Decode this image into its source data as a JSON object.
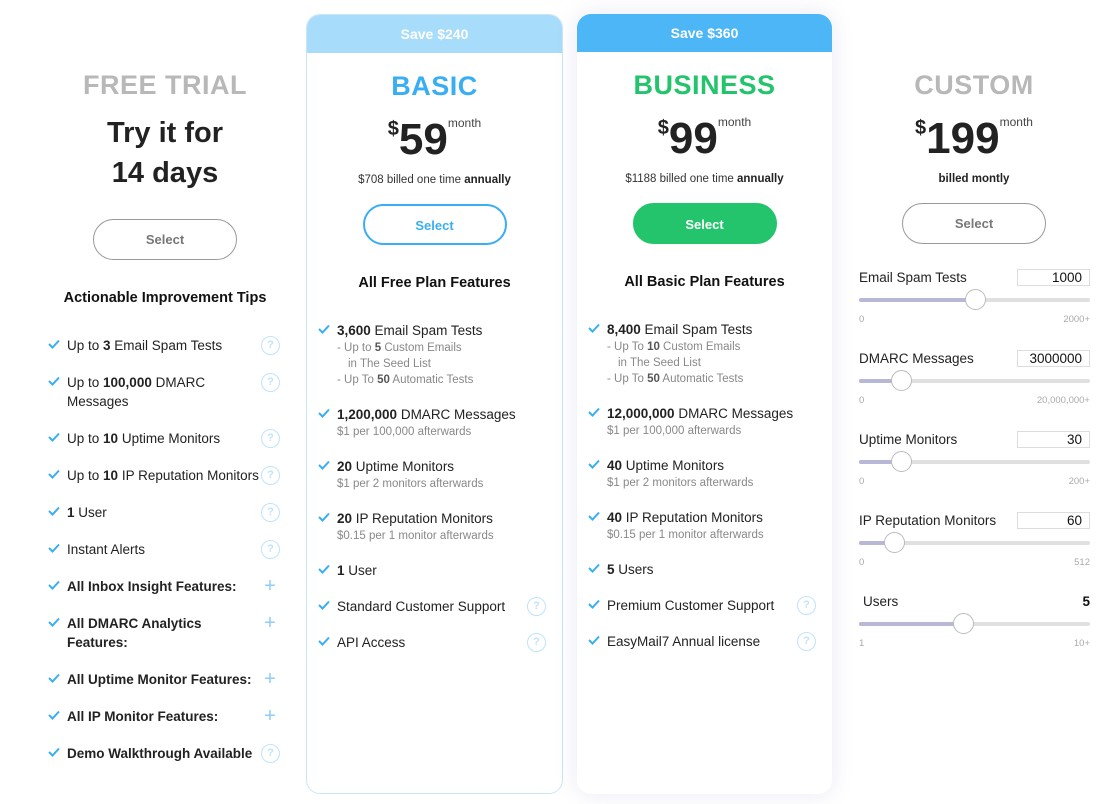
{
  "plans": {
    "free": {
      "title": "FREE TRIAL",
      "try_line1": "Try it for",
      "try_line2": "14 days",
      "select_label": "Select",
      "heading": "Actionable Improvement Tips",
      "features": [
        {
          "pre": "Up to ",
          "bold": "3",
          "post": " Email Spam Tests",
          "icon": "help-icon"
        },
        {
          "pre": "Up to ",
          "bold": "100,000",
          "post": " DMARC Messages",
          "icon": "help-icon"
        },
        {
          "pre": "Up to ",
          "bold": "10",
          "post": " Uptime Monitors",
          "icon": "help-icon"
        },
        {
          "pre": "Up to ",
          "bold": "10",
          "post": " IP Reputation Monitors",
          "icon": "help-icon"
        },
        {
          "pre": "",
          "bold": "1",
          "post": " User",
          "icon": "help-icon"
        },
        {
          "pre": "Instant Alerts",
          "bold": "",
          "post": "",
          "icon": "help-icon"
        },
        {
          "pre": "",
          "bold": "All Inbox Insight Features:",
          "post": "",
          "icon": "plus-icon"
        },
        {
          "pre": "",
          "bold": "All DMARC Analytics Features:",
          "post": "",
          "icon": "plus-icon"
        },
        {
          "pre": "",
          "bold": "All Uptime Monitor Features:",
          "post": "",
          "icon": "plus-icon"
        },
        {
          "pre": "",
          "bold": "All IP Monitor Features:",
          "post": "",
          "icon": "plus-icon"
        },
        {
          "pre": "",
          "bold": "Demo Walkthrough Available",
          "post": "",
          "icon": "help-icon"
        }
      ]
    },
    "basic": {
      "save_banner": "Save $240",
      "title": "BASIC",
      "currency": "$",
      "price": "59",
      "period": "month",
      "billing_pre": "$708 billed one time ",
      "billing_bold": "annually",
      "select_label": "Select",
      "heading": "All Free Plan Features",
      "spam": {
        "bold": "3,600",
        "post": " Email Spam Tests",
        "sub1_pre": "- Up to ",
        "sub1_bold": "5",
        "sub1_post": " Custom Emails",
        "sub2": "in The Seed List",
        "sub3_pre": "- Up To ",
        "sub3_bold": "50",
        "sub3_post": " Automatic Tests"
      },
      "dmarc": {
        "bold": "1,200,000",
        "post": " DMARC Messages",
        "sub": "$1 per 100,000 afterwards"
      },
      "uptime": {
        "bold": "20",
        "post": " Uptime Monitors",
        "sub": "$1 per 2 monitors afterwards"
      },
      "ip": {
        "bold": "20",
        "post": " IP Reputation Monitors",
        "sub": "$0.15 per 1 monitor afterwards"
      },
      "users": {
        "bold": "1",
        "post": " User"
      },
      "support": "Standard Customer Support",
      "extra": "API Access"
    },
    "business": {
      "save_banner": "Save $360",
      "title": "BUSINESS",
      "currency": "$",
      "price": "99",
      "period": "month",
      "billing_pre": "$1188 billed one time ",
      "billing_bold": "annually",
      "select_label": "Select",
      "heading": "All Basic Plan Features",
      "spam": {
        "bold": "8,400",
        "post": " Email Spam Tests",
        "sub1_pre": "- Up To ",
        "sub1_bold": "10",
        "sub1_post": " Custom Emails",
        "sub2": "in The Seed List",
        "sub3_pre": "- Up To ",
        "sub3_bold": "50",
        "sub3_post": " Automatic Tests"
      },
      "dmarc": {
        "bold": "12,000,000",
        "post": " DMARC Messages",
        "sub": "$1 per 100,000 afterwards"
      },
      "uptime": {
        "bold": "40",
        "post": " Uptime Monitors",
        "sub": "$1 per 2 monitors afterwards"
      },
      "ip": {
        "bold": "40",
        "post": " IP Reputation Monitors",
        "sub": "$0.15 per 1 monitor afterwards"
      },
      "users": {
        "bold": "5",
        "post": " Users"
      },
      "support": "Premium Customer Support",
      "extra": "EasyMail7 Annual license"
    },
    "custom": {
      "title": "CUSTOM",
      "currency": "$",
      "price": "199",
      "period": "month",
      "billing": "billed montly",
      "select_label": "Select",
      "sliders": [
        {
          "label": "Email Spam Tests",
          "value": "1000",
          "min_label": "0",
          "max_label": "2000+",
          "fraction": 0.5,
          "type": "input"
        },
        {
          "label": "DMARC Messages",
          "value": "3000000",
          "min_label": "0",
          "max_label": "20,000,000+",
          "fraction": 0.18,
          "type": "input"
        },
        {
          "label": "Uptime Monitors",
          "value": "30",
          "min_label": "0",
          "max_label": "200+",
          "fraction": 0.18,
          "type": "input"
        },
        {
          "label": "IP Reputation Monitors",
          "value": "60",
          "min_label": "0",
          "max_label": "512",
          "fraction": 0.15,
          "type": "input"
        },
        {
          "label": "Users",
          "value": "5",
          "min_label": "1",
          "max_label": "10+",
          "fraction": 0.45,
          "type": "static"
        }
      ]
    }
  },
  "colors": {
    "basic_accent": "#3aaef2",
    "business_accent": "#23c46b",
    "check": "#3aaef2",
    "muted_title": "#b8b8b8"
  }
}
